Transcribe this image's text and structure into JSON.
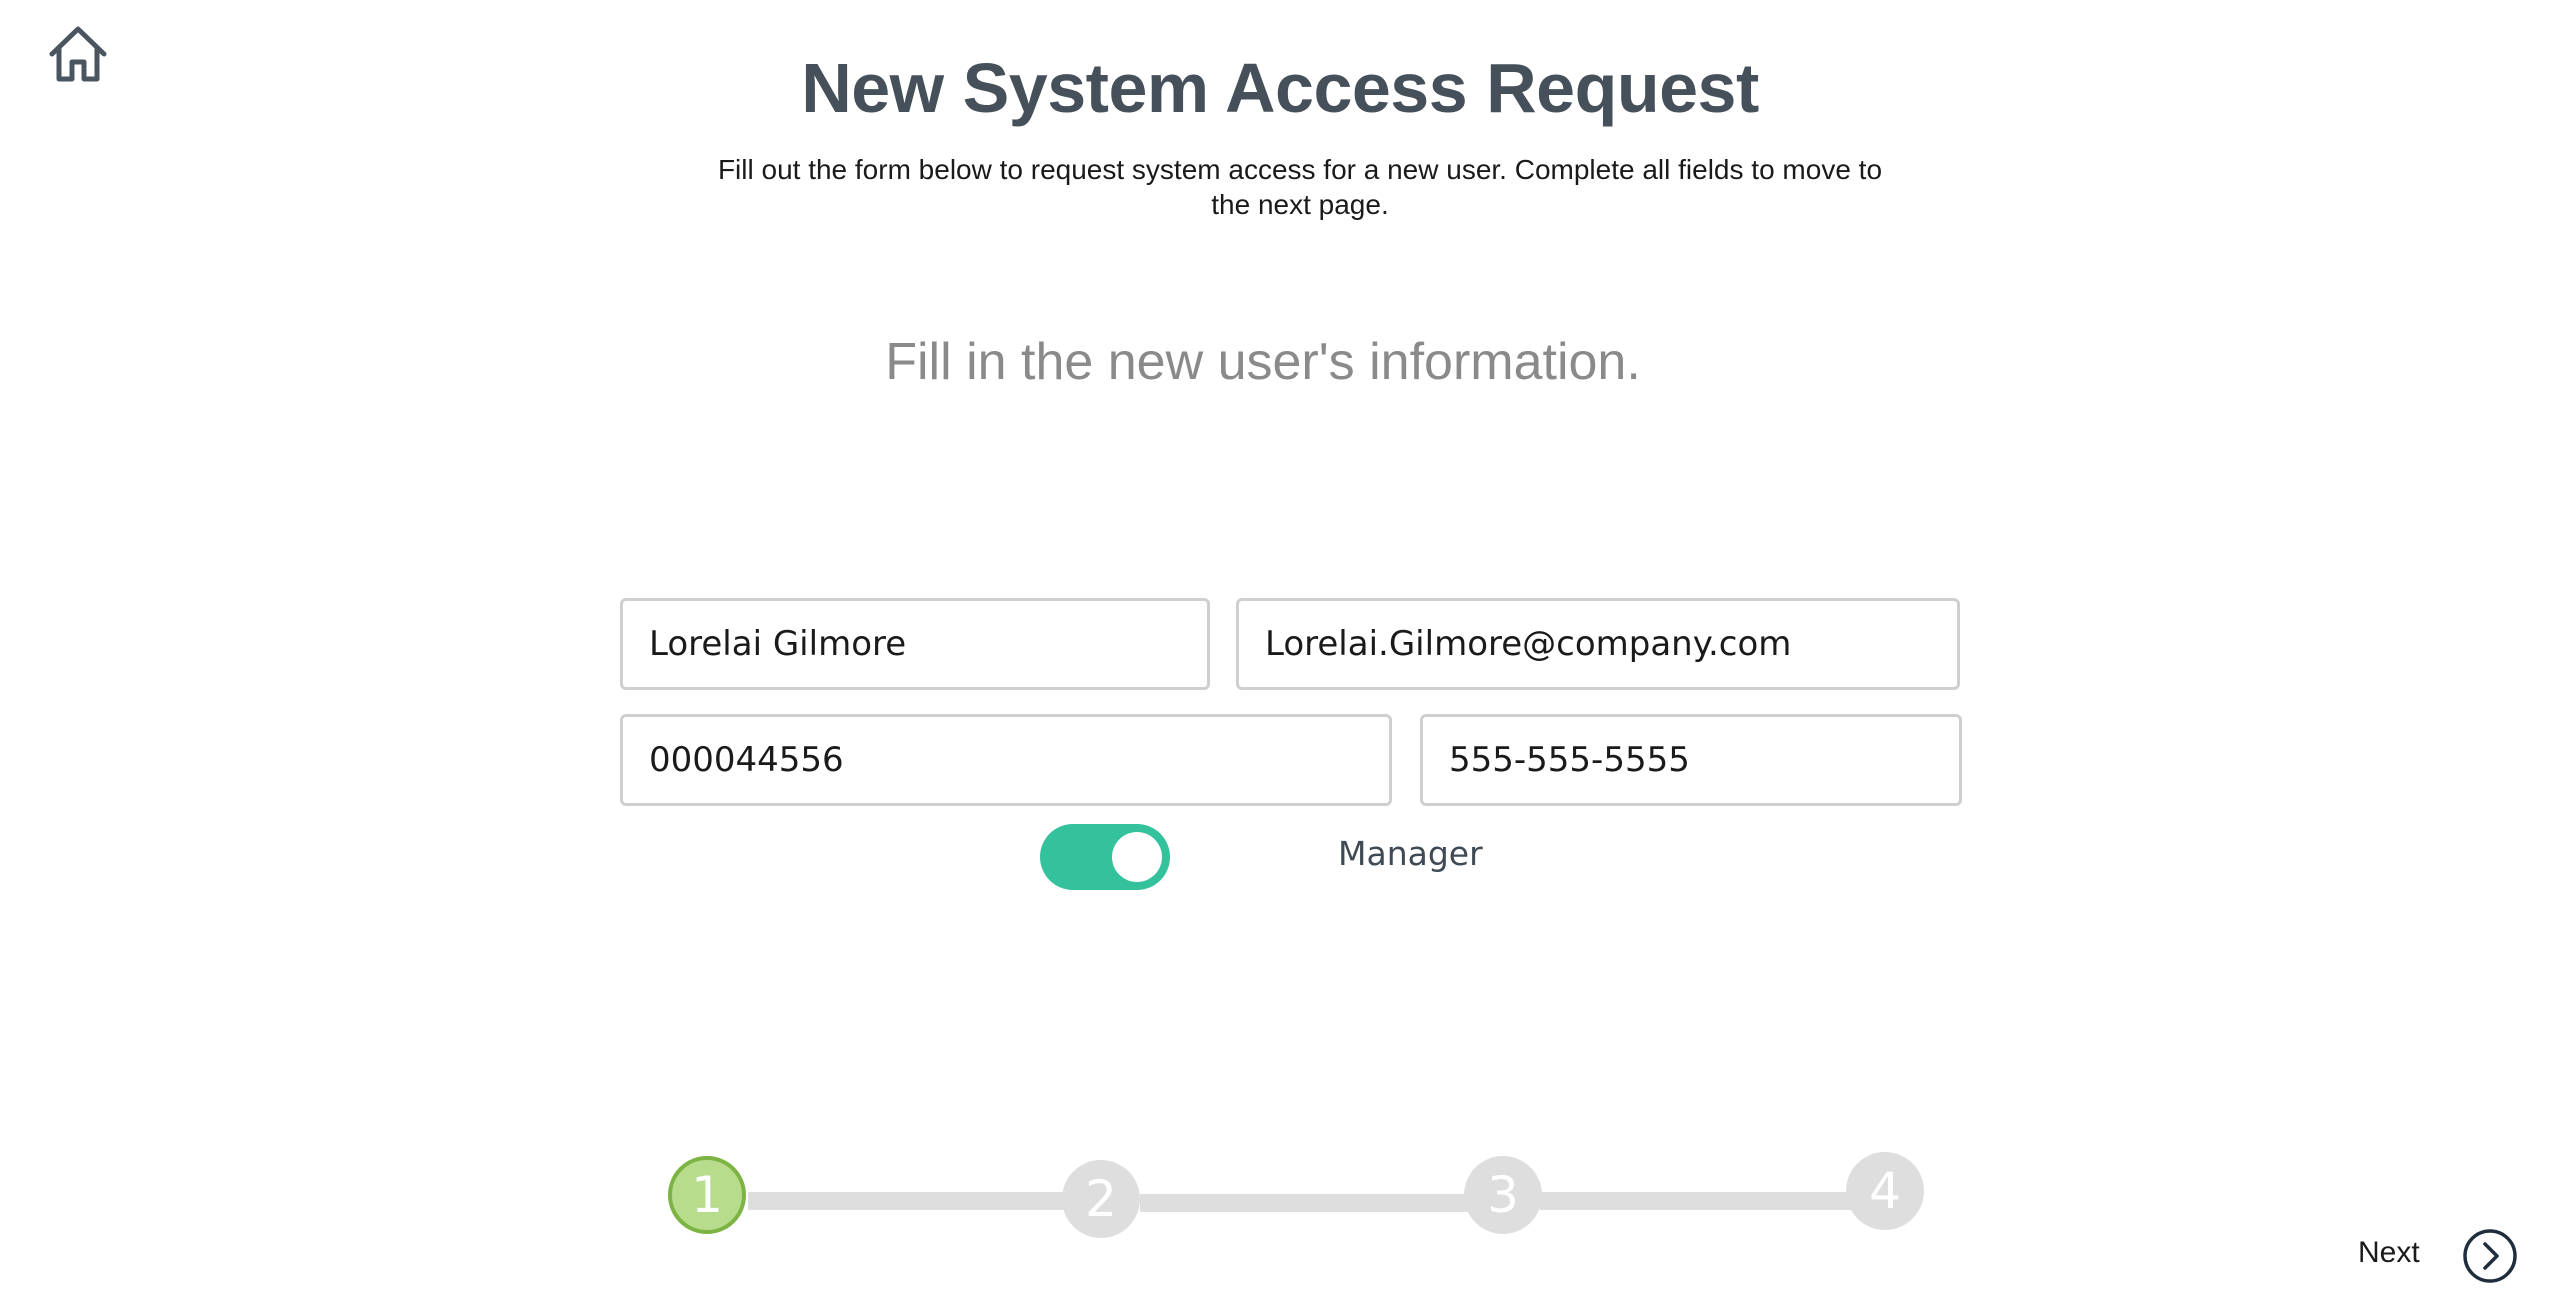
{
  "header": {
    "title": "New System Access Request",
    "description": "Fill out the form below to request system access for a new user. Complete all fields to move to the next page."
  },
  "form": {
    "section_heading": "Fill in the new user's information.",
    "full_name": "Lorelai Gilmore",
    "email": "Lorelai.Gilmore@company.com",
    "employee_id": "000044556",
    "phone": "555-555-5555",
    "manager_toggle": {
      "label": "Manager",
      "on": true
    }
  },
  "stepper": {
    "steps": [
      "1",
      "2",
      "3",
      "4"
    ],
    "current_step": 1
  },
  "navigation": {
    "next_label": "Next"
  },
  "icons": {
    "home": "home-icon",
    "next": "chevron-right-circle-icon"
  },
  "colors": {
    "title": "#46505a",
    "toggle_on": "#33c29b",
    "step_active_fill": "#b6dc8c",
    "step_active_border": "#7cb342",
    "step_inactive": "#dedede"
  }
}
